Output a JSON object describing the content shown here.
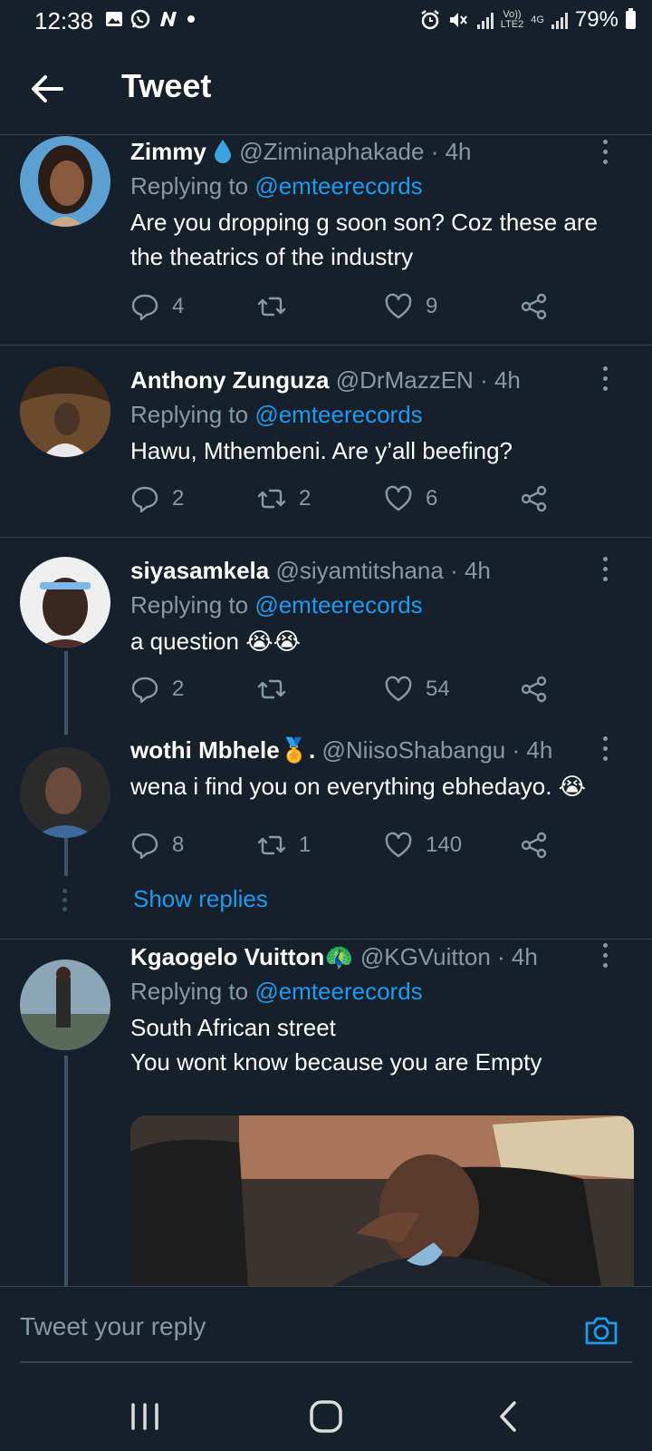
{
  "status_bar": {
    "time": "12:38",
    "left_icons": [
      "image-icon",
      "whatsapp-icon",
      "n-app-icon",
      "dot-icon"
    ],
    "volte_top": "Vo))",
    "volte_bottom": "LTE2",
    "network": "4G",
    "battery": "79%"
  },
  "header": {
    "title": "Tweet"
  },
  "tweets": [
    {
      "name": "Zimmy",
      "handle": "@Ziminaphakade",
      "time": "· 4h",
      "replying_prefix": "Replying to ",
      "replying_to": "@emteerecords",
      "text": "Are you dropping g soon son? Coz these are the theatrics of the industry",
      "replies": "4",
      "retweets": "",
      "likes": "9"
    },
    {
      "name": "Anthony Zunguza",
      "handle": "@DrMazzEN",
      "time": "· 4h",
      "replying_prefix": "Replying to ",
      "replying_to": "@emteerecords",
      "text": "Hawu, Mthembeni. Are y’all beefing?",
      "replies": "2",
      "retweets": "2",
      "likes": "6"
    },
    {
      "name": "siyasamkela",
      "handle": "@siyamtitshana",
      "time": "· 4h",
      "replying_prefix": "Replying to ",
      "replying_to": "@emteerecords",
      "text": "a question 😭😭",
      "replies": "2",
      "retweets": "",
      "likes": "54"
    },
    {
      "name": "wothi Mbhele🏅.",
      "handle": "@NiisoShabangu",
      "time": "· 4h",
      "text": "wena i find you on everything ebhedayo. 😭",
      "replies": "8",
      "retweets": "1",
      "likes": "140"
    },
    {
      "name": "Kgaogelo Vuitton🦚",
      "handle": "@KGVuitton",
      "time": "· 4h",
      "replying_prefix": "Replying to ",
      "replying_to": "@emteerecords",
      "text_line1": "South African street",
      "text_line2": "You wont know because you are Empty"
    }
  ],
  "show_replies": "Show replies",
  "composer": {
    "placeholder": "Tweet your reply"
  },
  "colors": {
    "background": "#15202b",
    "accent": "#1d9bf0",
    "muted": "#8899a6",
    "divider": "#38444d"
  }
}
